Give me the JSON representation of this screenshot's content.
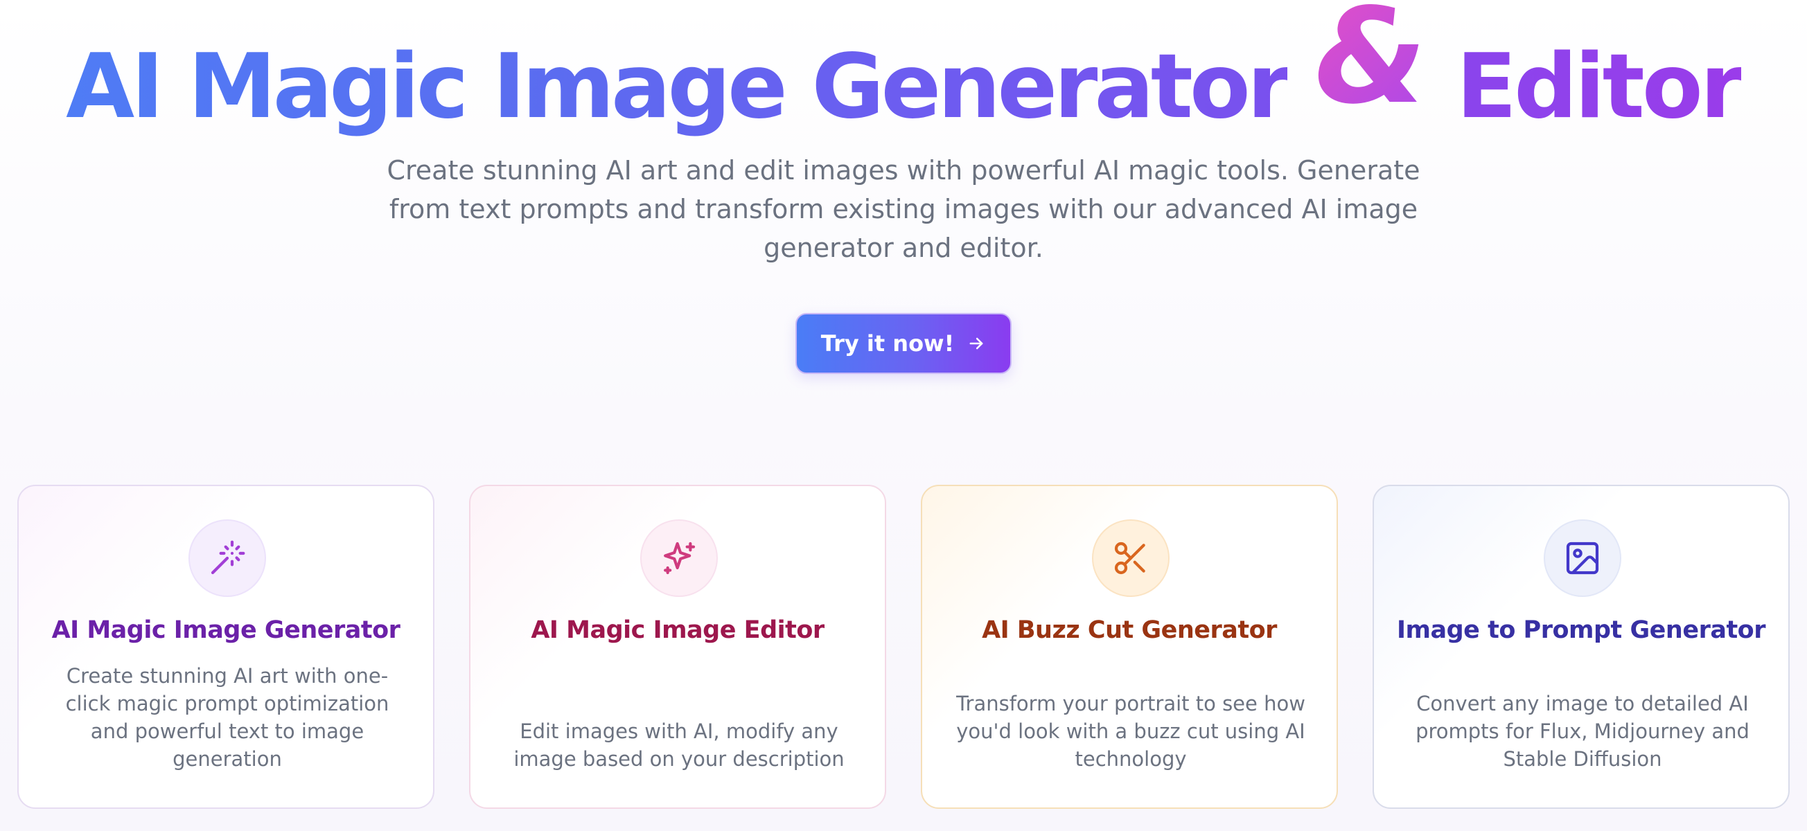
{
  "hero": {
    "title_main": "AI Magic Image Generator",
    "title_amp": "&",
    "title_end": "Editor",
    "subtitle": "Create stunning AI art and edit images with powerful AI magic tools. Generate from text prompts and transform existing images with our advanced AI image generator and editor.",
    "cta_label": "Try it now!"
  },
  "cards": [
    {
      "icon": "magic-wand-icon",
      "title": "AI Magic Image Generator",
      "description": "Create stunning AI art with one-click magic prompt optimization and powerful text to image generation",
      "accent": "#6b21a8"
    },
    {
      "icon": "sparkle-icon",
      "title": "AI Magic Image Editor",
      "description": "Edit images with AI, modify any image based on your description",
      "accent": "#9d174d"
    },
    {
      "icon": "scissors-icon",
      "title": "AI Buzz Cut Generator",
      "description": "Transform your portrait to see how you'd look with a buzz cut using AI technology",
      "accent": "#9a3412"
    },
    {
      "icon": "image-icon",
      "title": "Image to Prompt Generator",
      "description": "Convert any image to detailed AI prompts for Flux, Midjourney and Stable Diffusion",
      "accent": "#3730a3"
    }
  ],
  "colors": {
    "gradient_start": "#4a7df6",
    "gradient_end": "#8a3cf0",
    "amp_gradient_start": "#e04fc9",
    "text_muted": "#6b7280"
  }
}
